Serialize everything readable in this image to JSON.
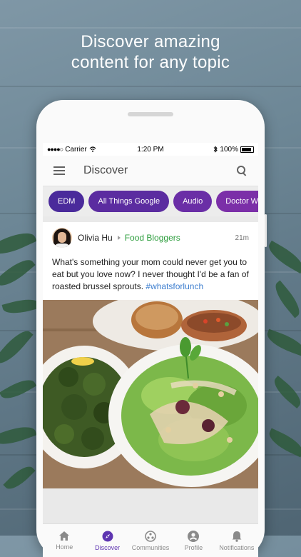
{
  "headline": {
    "line1": "Discover amazing",
    "line2": "content for any topic"
  },
  "status_bar": {
    "carrier": "Carrier",
    "time": "1:20 PM",
    "battery": "100%"
  },
  "app_bar": {
    "title": "Discover",
    "menu_icon": "hamburger-menu-icon",
    "search_icon": "search-icon"
  },
  "chips": [
    {
      "label": "EDM",
      "color": "#4a2a9b"
    },
    {
      "label": "All Things Google",
      "color": "#5b2ca0"
    },
    {
      "label": "Audio",
      "color": "#6a2ea6"
    },
    {
      "label": "Doctor Who",
      "color": "#7b2fa8"
    }
  ],
  "post": {
    "author": "Olivia Hu",
    "community": "Food Bloggers",
    "time": "21m",
    "text": "What's something your mom could never get you to eat but you love now? I never thought I'd be a fan of roasted brussel sprouts.",
    "hashtag": "#whatsforlunch",
    "community_color": "#2e9e3e"
  },
  "bottom_nav": [
    {
      "label": "Home",
      "icon": "home-icon",
      "active": false
    },
    {
      "label": "Discover",
      "icon": "compass-icon",
      "active": true
    },
    {
      "label": "Communities",
      "icon": "communities-icon",
      "active": false
    },
    {
      "label": "Profile",
      "icon": "profile-icon",
      "active": false
    },
    {
      "label": "Notifications",
      "icon": "bell-icon",
      "active": false
    }
  ],
  "colors": {
    "accent": "#5e35b1",
    "hashtag": "#3f7fcf"
  }
}
